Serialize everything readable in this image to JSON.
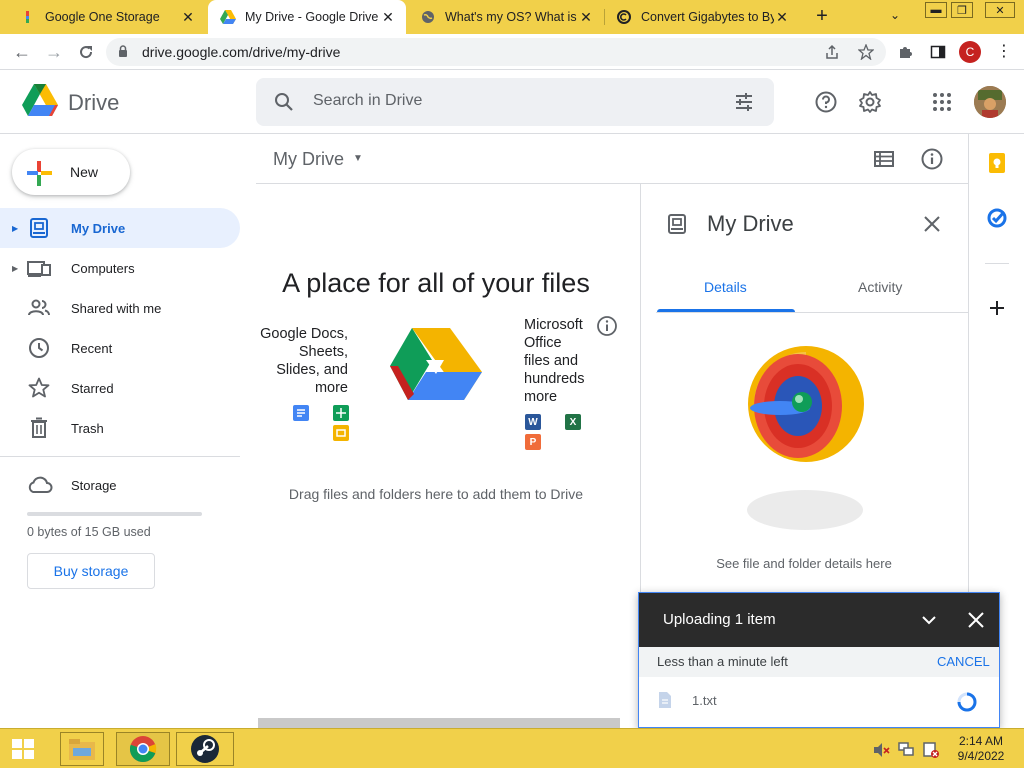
{
  "browser": {
    "tabs": [
      {
        "title": "Google One Storage",
        "icon": "google-one-icon",
        "active": false
      },
      {
        "title": "My Drive - Google Drive",
        "icon": "drive-icon",
        "active": true
      },
      {
        "title": "What's my OS? What is my",
        "icon": "globe-icon",
        "active": false
      },
      {
        "title": "Convert Gigabytes to Byt",
        "icon": "convert-icon",
        "active": false
      }
    ],
    "url": "drive.google.com/drive/my-drive",
    "profile_initial": "C"
  },
  "header": {
    "brand": "Drive",
    "search_placeholder": "Search in Drive"
  },
  "sidebar": {
    "new_label": "New",
    "items": [
      {
        "label": "My Drive",
        "icon": "my-drive-icon",
        "active": true,
        "expandable": true
      },
      {
        "label": "Computers",
        "icon": "computers-icon",
        "active": false,
        "expandable": true
      },
      {
        "label": "Shared with me",
        "icon": "shared-icon",
        "active": false,
        "expandable": false
      },
      {
        "label": "Recent",
        "icon": "clock-icon",
        "active": false,
        "expandable": false
      },
      {
        "label": "Starred",
        "icon": "star-icon",
        "active": false,
        "expandable": false
      },
      {
        "label": "Trash",
        "icon": "trash-icon",
        "active": false,
        "expandable": false
      }
    ],
    "storage_label": "Storage",
    "storage_used": "0 bytes of 15 GB used",
    "storage_fraction": 0,
    "buy_label": "Buy storage"
  },
  "main": {
    "title": "My Drive",
    "empty_heading": "A place for all of your files",
    "google_text": [
      "Google Docs,",
      "Sheets,",
      "Slides, and",
      "more"
    ],
    "office_text": [
      "Microsoft",
      "Office",
      "files and",
      "hundreds",
      "more"
    ],
    "office_letters": {
      "word": "W",
      "excel": "X",
      "powerpoint": "P"
    },
    "drag_text": "Drag files and folders here to add them to Drive"
  },
  "details": {
    "title": "My Drive",
    "tabs": [
      "Details",
      "Activity"
    ],
    "active_tab": "Details",
    "caption": "See file and folder details here"
  },
  "upload": {
    "title": "Uploading 1 item",
    "status": "Less than a minute left",
    "cancel_label": "CANCEL",
    "file_name": "1.txt"
  },
  "taskbar": {
    "time": "2:14 AM",
    "date": "9/4/2022"
  },
  "colors": {
    "accent": "#1a73e8",
    "active_nav_bg": "#e8f0fe",
    "chrome_yellow": "#f1d04a",
    "toast_header": "#2b2b2b"
  }
}
